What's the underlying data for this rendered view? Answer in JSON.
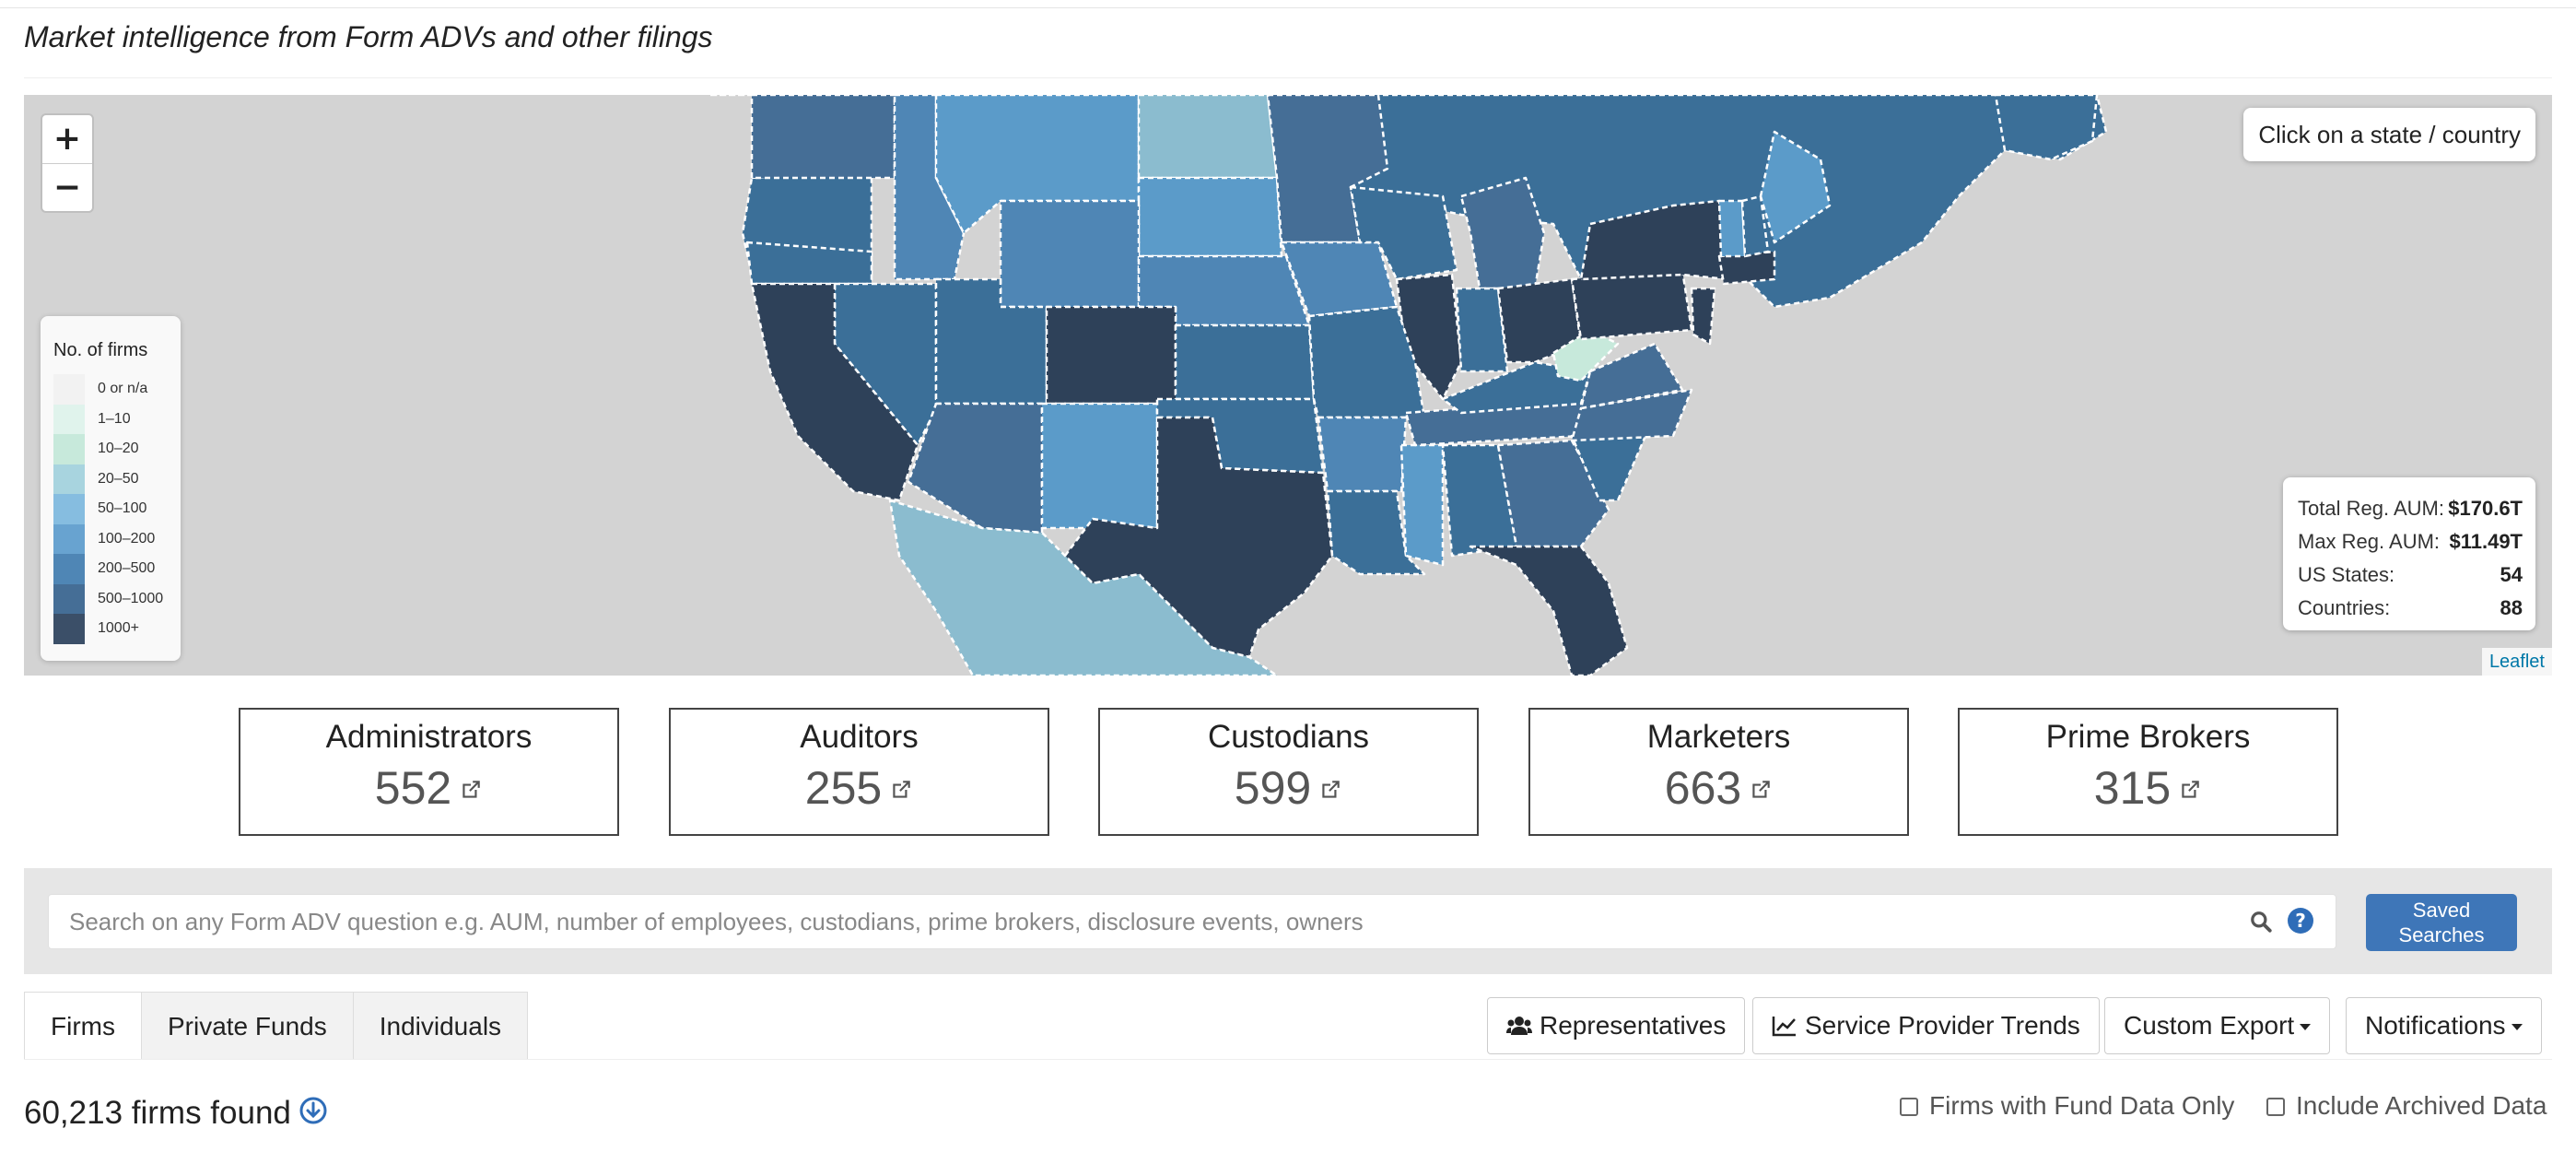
{
  "header": {
    "subtitle": "Market intelligence from Form ADVs and other filings"
  },
  "map": {
    "zoom_in": "+",
    "zoom_out": "−",
    "hint": "Click on a state / country",
    "legend": {
      "title": "No. of firms",
      "bins": [
        {
          "label": "0 or n/a",
          "color": "#f2f2f2"
        },
        {
          "label": "1–10",
          "color": "#e0f3ec"
        },
        {
          "label": "10–20",
          "color": "#c7e9db"
        },
        {
          "label": "20–50",
          "color": "#a8d4df"
        },
        {
          "label": "50–100",
          "color": "#86bde0"
        },
        {
          "label": "100–200",
          "color": "#68a3d0"
        },
        {
          "label": "200–500",
          "color": "#4f86b5"
        },
        {
          "label": "500–1000",
          "color": "#456e96"
        },
        {
          "label": "1000+",
          "color": "#3b4f68"
        }
      ]
    },
    "stats": [
      {
        "label": "Total Reg. AUM:",
        "value": "$170.6T"
      },
      {
        "label": "Max Reg. AUM:",
        "value": "$11.49T"
      },
      {
        "label": "US States:",
        "value": "54"
      },
      {
        "label": "Countries:",
        "value": "88"
      }
    ],
    "attribution": "Leaflet"
  },
  "cards": [
    {
      "title": "Administrators",
      "value": "552"
    },
    {
      "title": "Auditors",
      "value": "255"
    },
    {
      "title": "Custodians",
      "value": "599"
    },
    {
      "title": "Marketers",
      "value": "663"
    },
    {
      "title": "Prime Brokers",
      "value": "315"
    }
  ],
  "search": {
    "placeholder": "Search on any Form ADV question e.g. AUM, number of employees, custodians, prime brokers, disclosure events, owners",
    "help": "?",
    "saved_label_1": "Saved",
    "saved_label_2": "Searches"
  },
  "tabs": [
    "Firms",
    "Private Funds",
    "Individuals"
  ],
  "actions": {
    "representatives": "Representatives",
    "trends": "Service Provider Trends",
    "export": "Custom Export",
    "notifications": "Notifications"
  },
  "results": {
    "count_text": "60,213 firms found",
    "fund_data_only": "Firms with Fund Data Only",
    "include_archived": "Include Archived Data"
  },
  "colors": {
    "accent": "#3e76b8",
    "map_bg": "#d3d3d3",
    "dark_state": "#2e4159",
    "mid_state": "#3b6f98",
    "light_state": "#8bbccf"
  }
}
